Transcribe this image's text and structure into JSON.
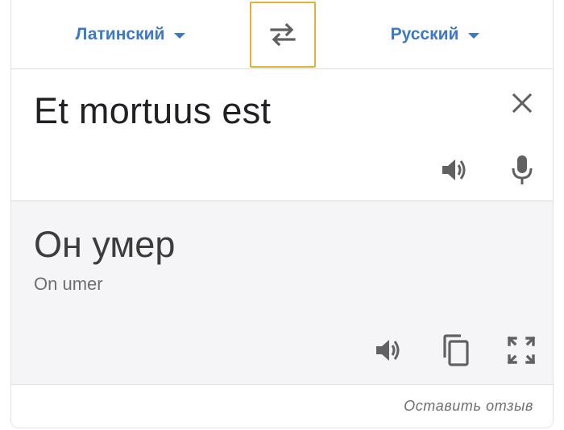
{
  "languages": {
    "source": "Латинский",
    "target": "Русский"
  },
  "icons": {
    "swap": "swap-arrows-icon",
    "clear": "close-icon",
    "source_speaker": "speaker-icon",
    "mic": "microphone-icon",
    "result_speaker": "speaker-icon",
    "copy": "copy-icon",
    "fullscreen": "fullscreen-icon"
  },
  "source": {
    "text": "Et mortuus est"
  },
  "result": {
    "text": "Он умер",
    "transliteration": "On umer"
  },
  "footer": {
    "feedback_label": "Оставить отзыв"
  },
  "colors": {
    "accent": "#3b78c9",
    "focus_outline": "#e0b139",
    "icon": "#616161",
    "result_bg": "#f5f5f7"
  }
}
